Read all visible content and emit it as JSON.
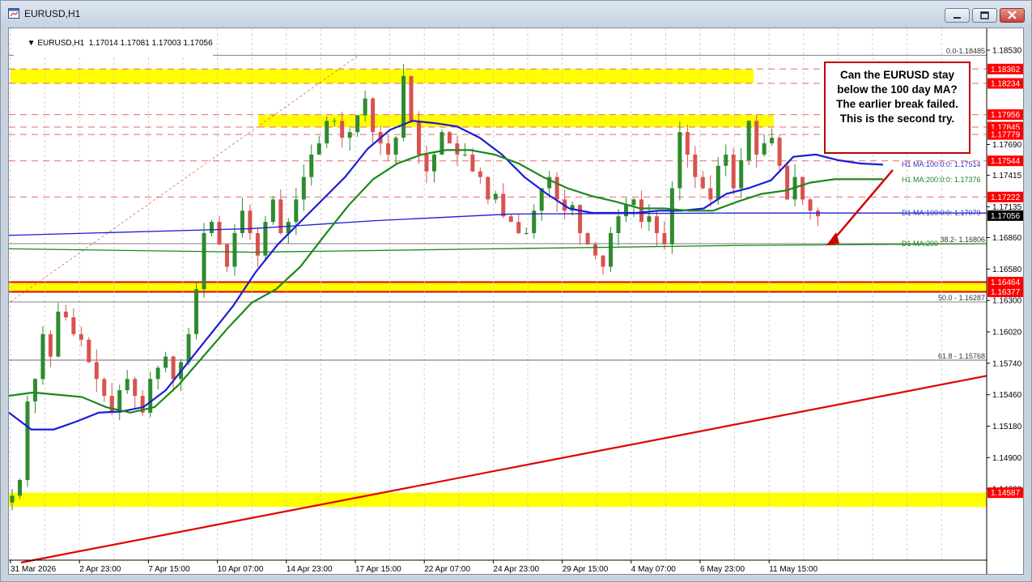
{
  "window": {
    "title": "EURUSD,H1"
  },
  "chart_header": {
    "symbol_info": "EURUSD,H1  1.17014 1.17081 1.17003 1.17056"
  },
  "callout": {
    "text": "Can the EURUSD stay below the 100 day MA? The earlier break failed. This is the second try."
  },
  "colors": {
    "bull_candle": "#2e8b2e",
    "bear_candle": "#d8534f",
    "zone_yellow": "#ffff00",
    "h1_ma100": "#1c1cd6",
    "h1_ma200": "#1a8a1a",
    "trendline": "#e00000",
    "price_label_bg": "#ff0000",
    "current_price_bg": "#000000"
  },
  "chart_data": {
    "type": "candlestick",
    "symbol": "EURUSD",
    "timeframe": "H1",
    "ohlc_last": {
      "open": 1.17014,
      "high": 1.17081,
      "low": 1.17003,
      "close": 1.17056
    },
    "ylim": [
      1.1446,
      1.186
    ],
    "price_ticks": [
      1.1853,
      1.1769,
      1.17415,
      1.17135,
      1.1686,
      1.1658,
      1.163,
      1.1602,
      1.1574,
      1.1546,
      1.1518,
      1.149,
      1.1462
    ],
    "x_ticks": [
      "31 Mar 2026",
      "2 Apr 23:00",
      "7 Apr 15:00",
      "10 Apr 07:00",
      "14 Apr 23:00",
      "17 Apr 15:00",
      "22 Apr 07:00",
      "24 Apr 23:00",
      "29 Apr 15:00",
      "4 May 07:00",
      "6 May 23:00",
      "11 May 15:00"
    ],
    "price_labels": [
      {
        "value": "1.18362",
        "type": "resistance"
      },
      {
        "value": "1.18234",
        "type": "resistance"
      },
      {
        "value": "1.17956",
        "type": "resistance"
      },
      {
        "value": "1.17845",
        "type": "resistance"
      },
      {
        "value": "1.17779",
        "type": "resistance"
      },
      {
        "value": "1.17544",
        "type": "ma"
      },
      {
        "value": "1.17222",
        "type": "resistance"
      },
      {
        "value": "1.17056",
        "type": "current"
      },
      {
        "value": "1.16464",
        "type": "support"
      },
      {
        "value": "1.16377",
        "type": "support"
      },
      {
        "value": "1.14587",
        "type": "support"
      }
    ],
    "yellow_zones": [
      {
        "low": 1.18234,
        "high": 1.18362
      },
      {
        "low": 1.17845,
        "high": 1.17956
      },
      {
        "low": 1.16377,
        "high": 1.16464
      },
      {
        "low": 1.1446,
        "high": 1.14587
      }
    ],
    "fibonacci": [
      {
        "label": "0.0",
        "level": 1.18485,
        "text": "0.0-1.18485"
      },
      {
        "label": "38.2",
        "level": 1.16806,
        "text": "38.2- 1.16806"
      },
      {
        "label": "50.0",
        "level": 1.16287,
        "text": "50.0 - 1.16287"
      },
      {
        "label": "61.8",
        "level": 1.15768,
        "text": "61.8 - 1.15768"
      }
    ],
    "moving_averages": [
      {
        "name": "H1 MA:100:0:0: 1.17514",
        "value": 1.17514
      },
      {
        "name": "H1 MA:200:0:0: 1.17376",
        "value": 1.17376
      },
      {
        "name": "D1 MA:100:0:0: 1.17079",
        "value": 1.17079
      },
      {
        "name": "D1 MA:200",
        "value": 1.16806
      }
    ],
    "series": {
      "close": [
        1.1456,
        1.147,
        1.154,
        1.156,
        1.16,
        1.158,
        1.162,
        1.1615,
        1.16,
        1.1595,
        1.1575,
        1.156,
        1.1545,
        1.153,
        1.155,
        1.156,
        1.1545,
        1.153,
        1.156,
        1.157,
        1.158,
        1.156,
        1.1575,
        1.16,
        1.164,
        1.169,
        1.17,
        1.168,
        1.166,
        1.169,
        1.171,
        1.169,
        1.167,
        1.17,
        1.172,
        1.169,
        1.17,
        1.172,
        1.174,
        1.176,
        1.177,
        1.179,
        1.179,
        1.1775,
        1.178,
        1.1795,
        1.181,
        1.178,
        1.177,
        1.176,
        1.1775,
        1.183,
        1.179,
        1.176,
        1.1745,
        1.176,
        1.178,
        1.177,
        1.176,
        1.176,
        1.1745,
        1.174,
        1.172,
        1.1725,
        1.1705,
        1.17,
        1.169,
        1.169,
        1.171,
        1.173,
        1.174,
        1.172,
        1.171,
        1.1715,
        1.169,
        1.168,
        1.167,
        1.166,
        1.169,
        1.1705,
        1.1715,
        1.172,
        1.17,
        1.1705,
        1.169,
        1.168,
        1.173,
        1.178,
        1.176,
        1.174,
        1.173,
        1.172,
        1.175,
        1.176,
        1.173,
        1.1755,
        1.179,
        1.176,
        1.177,
        1.1775,
        1.175,
        1.172,
        1.174,
        1.172,
        1.171,
        1.1705
      ],
      "h1_ma100": [
        1.153,
        1.1515,
        1.1515,
        1.1522,
        1.153,
        1.1531,
        1.1535,
        1.155,
        1.1575,
        1.16,
        1.1625,
        1.1655,
        1.168,
        1.17,
        1.172,
        1.174,
        1.1765,
        1.1782,
        1.179,
        1.1788,
        1.1785,
        1.1775,
        1.176,
        1.174,
        1.1725,
        1.1712,
        1.1708,
        1.1708,
        1.1708,
        1.171,
        1.171,
        1.1712,
        1.1725,
        1.173,
        1.1737,
        1.1758,
        1.176,
        1.1755,
        1.1752,
        1.1751
      ],
      "h1_ma200": [
        1.1545,
        1.1548,
        1.1546,
        1.1544,
        1.1535,
        1.153,
        1.1535,
        1.1555,
        1.158,
        1.1605,
        1.1628,
        1.164,
        1.166,
        1.1688,
        1.1715,
        1.1738,
        1.1752,
        1.176,
        1.1764,
        1.1764,
        1.176,
        1.1752,
        1.174,
        1.173,
        1.1723,
        1.1718,
        1.1712,
        1.1712,
        1.171,
        1.171,
        1.1718,
        1.1725,
        1.1728,
        1.1735,
        1.1738,
        1.1738,
        1.1738
      ]
    }
  }
}
